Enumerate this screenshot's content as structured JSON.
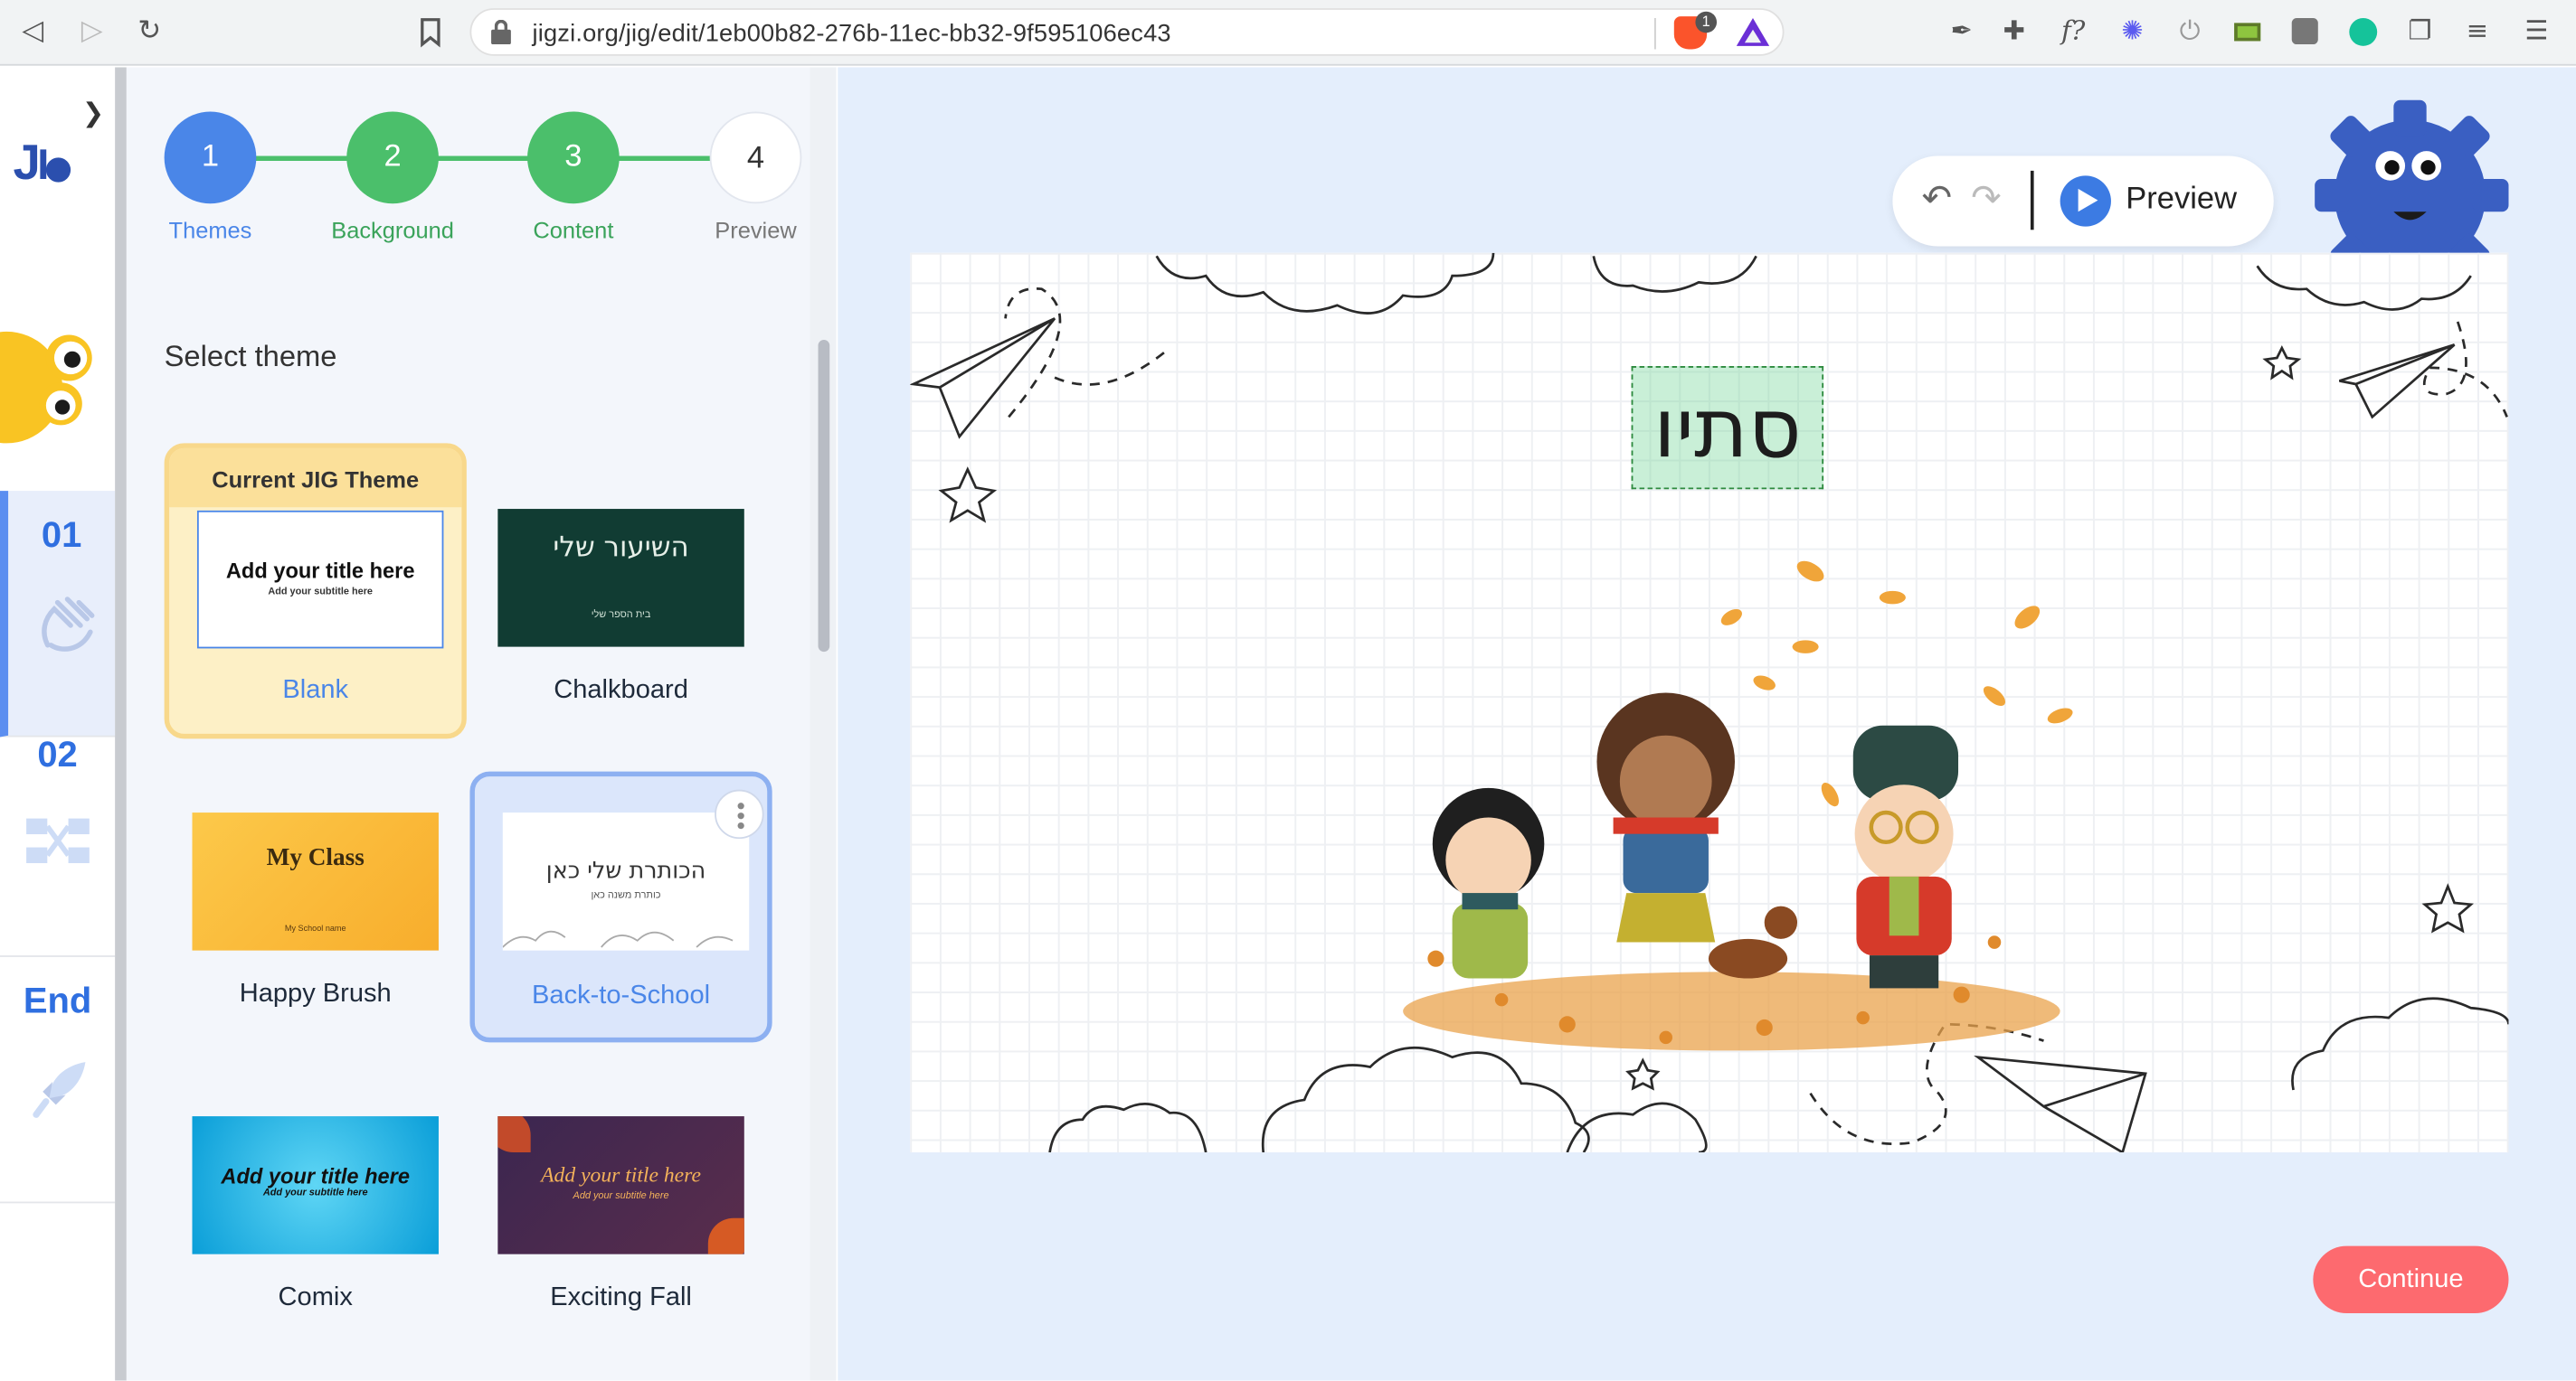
{
  "browser": {
    "url": "jigzi.org/jig/edit/1eb00b82-276b-11ec-bb32-9f595106ec43",
    "shields_count": "1",
    "back_icon": "back-arrow-icon",
    "forward_icon": "forward-arrow-icon",
    "reload_icon": "reload-icon",
    "bookmark_icon": "bookmark-icon",
    "extension_fx_label": "f?"
  },
  "sidebar": {
    "expand_icon": "chevron-right-icon",
    "logo_text": "JIG",
    "sections": [
      {
        "label": "01",
        "icon": "waving-hand-icon",
        "active": true
      },
      {
        "label": "02",
        "icon": "module-diagram-icon",
        "active": false
      },
      {
        "label": "End",
        "icon": "rocket-icon",
        "active": false
      }
    ]
  },
  "stepper": {
    "steps": [
      {
        "number": "1",
        "label": "Themes",
        "state": "current",
        "color": "#4a86e8"
      },
      {
        "number": "2",
        "label": "Background",
        "state": "done",
        "color": "#4bbf6b"
      },
      {
        "number": "3",
        "label": "Content",
        "state": "done",
        "color": "#4bbf6b"
      },
      {
        "number": "4",
        "label": "Preview",
        "state": "pending",
        "color": "#ffffff"
      }
    ]
  },
  "panel": {
    "title": "Select theme",
    "current_badge": "Current JIG Theme",
    "themes": [
      {
        "name": "Blank",
        "title": "Add your title here",
        "subtitle": "Add your subtitle here"
      },
      {
        "name": "Chalkboard",
        "title": "השיעור שלי",
        "subtitle": "בית הספר שלי"
      },
      {
        "name": "Happy Brush",
        "title": "My Class",
        "subtitle": "My School name"
      },
      {
        "name": "Back-to-School",
        "title": "הכותרת שלי כאן",
        "subtitle": "כותרת משנה כאן"
      },
      {
        "name": "Comix",
        "title": "Add your title here",
        "subtitle": "Add your subtitle here"
      },
      {
        "name": "Exciting Fall",
        "title": "Add your title here",
        "subtitle": "Add your subtitle here"
      }
    ]
  },
  "toolbar": {
    "undo_icon": "undo-icon",
    "redo_icon": "redo-icon",
    "preview_label": "Preview"
  },
  "canvas": {
    "text_box": "סתיו"
  },
  "footer": {
    "continue_label": "Continue"
  },
  "colors": {
    "primary_blue": "#4a86e8",
    "step_green": "#4bbf6b",
    "continue_red": "#fd6a6f",
    "canvas_bg": "#e4eefc"
  }
}
